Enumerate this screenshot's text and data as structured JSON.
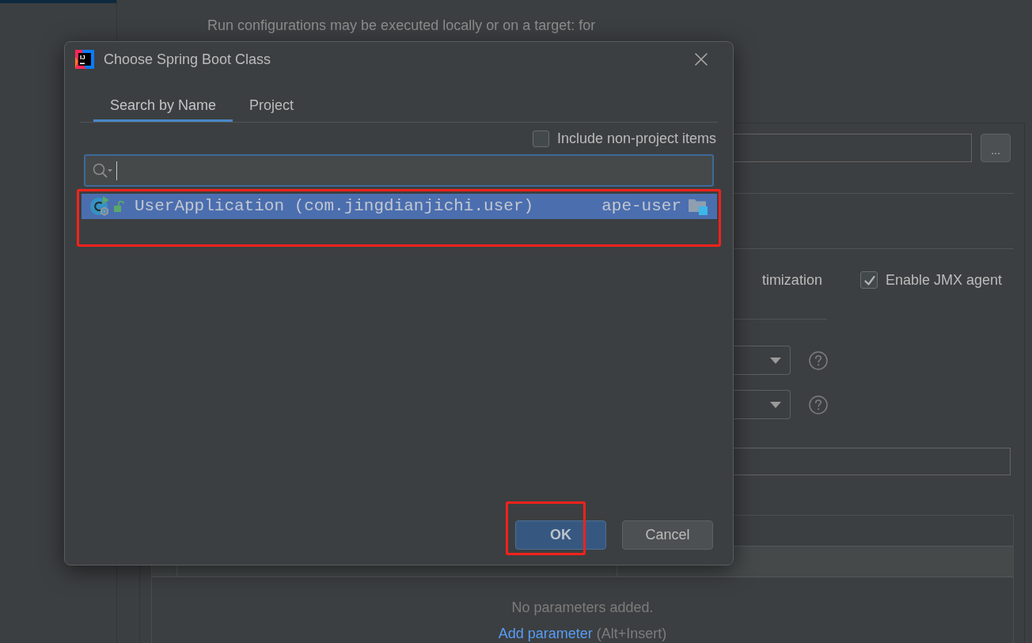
{
  "background": {
    "description": "Run configurations may be executed locally or on a target: for",
    "browse_button": "...",
    "options": [
      {
        "kind": "label",
        "label": "timization"
      },
      {
        "kind": "checkbox",
        "label": "Enable JMX agent",
        "checked": true
      }
    ],
    "parameters": {
      "empty_text": "No parameters added.",
      "add_link": "Add parameter",
      "shortcut": "(Alt+Insert)"
    }
  },
  "dialog": {
    "logo_text": "IJ",
    "title": "Choose Spring Boot Class",
    "tabs": [
      {
        "label": "Search by Name",
        "selected": true
      },
      {
        "label": "Project",
        "selected": false
      }
    ],
    "include_non_project": {
      "label": "Include non-project items",
      "checked": false
    },
    "results": [
      {
        "name": "UserApplication (com.jingdianjichi.user)",
        "module": "ape-user",
        "selected": true,
        "annotated": true
      }
    ],
    "buttons": [
      {
        "label": "OK",
        "kind": "primary",
        "annotated": true
      },
      {
        "label": "Cancel",
        "kind": "secondary",
        "annotated": false
      }
    ]
  }
}
